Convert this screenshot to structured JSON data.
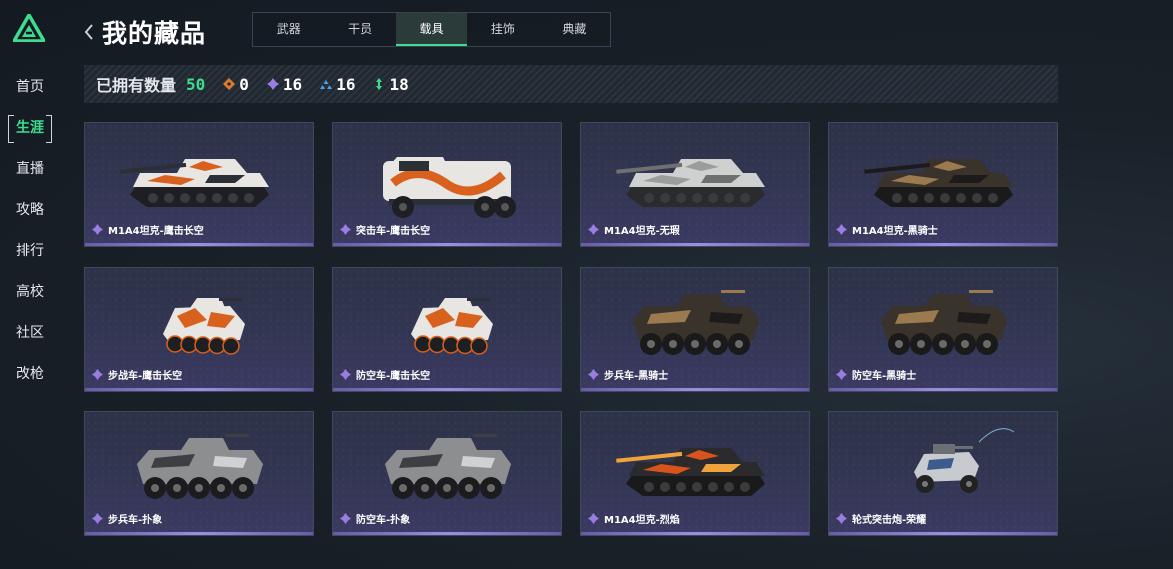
{
  "sidebar": {
    "items": [
      {
        "label": "首页"
      },
      {
        "label": "生涯"
      },
      {
        "label": "直播"
      },
      {
        "label": "攻略"
      },
      {
        "label": "排行"
      },
      {
        "label": "高校"
      },
      {
        "label": "社区"
      },
      {
        "label": "改枪"
      }
    ],
    "active_index": 1
  },
  "header": {
    "title": "我的藏品",
    "tabs": [
      {
        "label": "武器"
      },
      {
        "label": "干员"
      },
      {
        "label": "载具"
      },
      {
        "label": "挂饰"
      },
      {
        "label": "典藏"
      }
    ],
    "active_tab": 2
  },
  "stats": {
    "label": "已拥有数量",
    "total": "50",
    "items": [
      {
        "icon": "orange-diamond-icon",
        "color": "#e07a2c",
        "value": "0"
      },
      {
        "icon": "purple-diamond-icon",
        "color": "#9a7de0",
        "value": "16"
      },
      {
        "icon": "blue-triangle-icon",
        "color": "#4aa3e8",
        "value": "16"
      },
      {
        "icon": "green-arrows-icon",
        "color": "#3ddc8f",
        "value": "18"
      }
    ]
  },
  "items": [
    {
      "name": "M1A4坦克-鹰击长空",
      "vehicle": "tank",
      "theme": "orange-camo"
    },
    {
      "name": "突击车-鹰击长空",
      "vehicle": "truck",
      "theme": "orange-camo"
    },
    {
      "name": "M1A4坦克-无瑕",
      "vehicle": "tank",
      "theme": "white"
    },
    {
      "name": "M1A4坦克-黑骑士",
      "vehicle": "tank",
      "theme": "black-gold"
    },
    {
      "name": "步战车-鹰击长空",
      "vehicle": "ifv-small",
      "theme": "orange-camo"
    },
    {
      "name": "防空车-鹰击长空",
      "vehicle": "ifv-small",
      "theme": "orange-camo"
    },
    {
      "name": "步兵车-黑骑士",
      "vehicle": "apc",
      "theme": "black-gold"
    },
    {
      "name": "防空车-黑骑士",
      "vehicle": "apc",
      "theme": "black-gold"
    },
    {
      "name": "步兵车-扑象",
      "vehicle": "apc",
      "theme": "grey-camo"
    },
    {
      "name": "防空车-扑象",
      "vehicle": "apc",
      "theme": "grey-camo"
    },
    {
      "name": "M1A4坦克-烈焰",
      "vehicle": "tank",
      "theme": "flame"
    },
    {
      "name": "轮式突击炮-荣耀",
      "vehicle": "buggy",
      "theme": "silver"
    }
  ],
  "rarity": {
    "icon": "purple-diamond-icon",
    "color": "#9a7de0"
  },
  "accent_color": "#3ddc8f"
}
